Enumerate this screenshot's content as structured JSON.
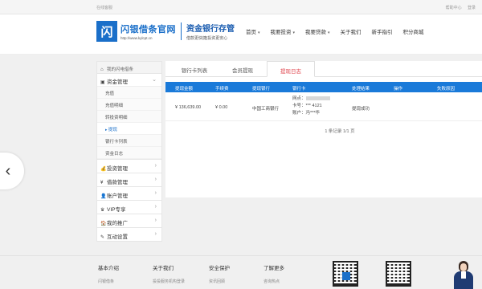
{
  "topbar": {
    "left_text": "在线客服",
    "help": "帮助中心",
    "login": "登录"
  },
  "header": {
    "logo_glyph": "闪",
    "logo_name": "闪银借条官网",
    "logo_url": "http://www.kylcpt.cn",
    "slogan_main": "资金银行存管",
    "slogan_sub": "借款更快捷|投资更安心",
    "brand_color": "#1a6fc9"
  },
  "nav": [
    {
      "label": "首页",
      "caret": "▾"
    },
    {
      "label": "我要投资",
      "caret": "▾"
    },
    {
      "label": "我要贷款",
      "caret": "▾"
    },
    {
      "label": "关于我们",
      "caret": ""
    },
    {
      "label": "新手指引",
      "caret": ""
    },
    {
      "label": "积分商城",
      "caret": ""
    }
  ],
  "sidebar": {
    "home": "我的闪电借条",
    "fund_group": "资金管理",
    "fund_items": [
      "充值",
      "充值明细",
      "转投资明细",
      "提现",
      "银行卡列表",
      "资金日志"
    ],
    "menus": [
      {
        "icon": "💰",
        "label": "投资管理"
      },
      {
        "icon": "¥",
        "label": "借款管理"
      },
      {
        "icon": "👤",
        "label": "账户管理"
      },
      {
        "icon": "♛",
        "label": "VIP专享"
      },
      {
        "icon": "🏠",
        "label": "我的推广"
      },
      {
        "icon": "✎",
        "label": "互动设置"
      }
    ]
  },
  "tabs": [
    "银行卡列表",
    "会员提现",
    "提现日志"
  ],
  "table": {
    "headers": [
      "提现金额",
      "手续费",
      "提现银行",
      "银行卡",
      "处理结果",
      "操作",
      "失败原因"
    ],
    "row": {
      "amount": "¥ 136,639.00",
      "fee": "¥ 0.00",
      "bank": "中国工商银行",
      "card_branch_label": "网点：",
      "card_no": "卡号：*** 4121",
      "card_holder": "账户：冯***华",
      "result": "提现成功",
      "action": "",
      "reason": ""
    }
  },
  "pager": "1 条记录 1/1 页",
  "footer": [
    {
      "title": "基本介绍",
      "link": "闪银借条"
    },
    {
      "title": "关于我们",
      "link": "投投服务机构登录"
    },
    {
      "title": "安全保护",
      "link": "资讯回顾"
    },
    {
      "title": "了解更多",
      "link": "咨询热点"
    }
  ],
  "prev_arrow": "‹"
}
